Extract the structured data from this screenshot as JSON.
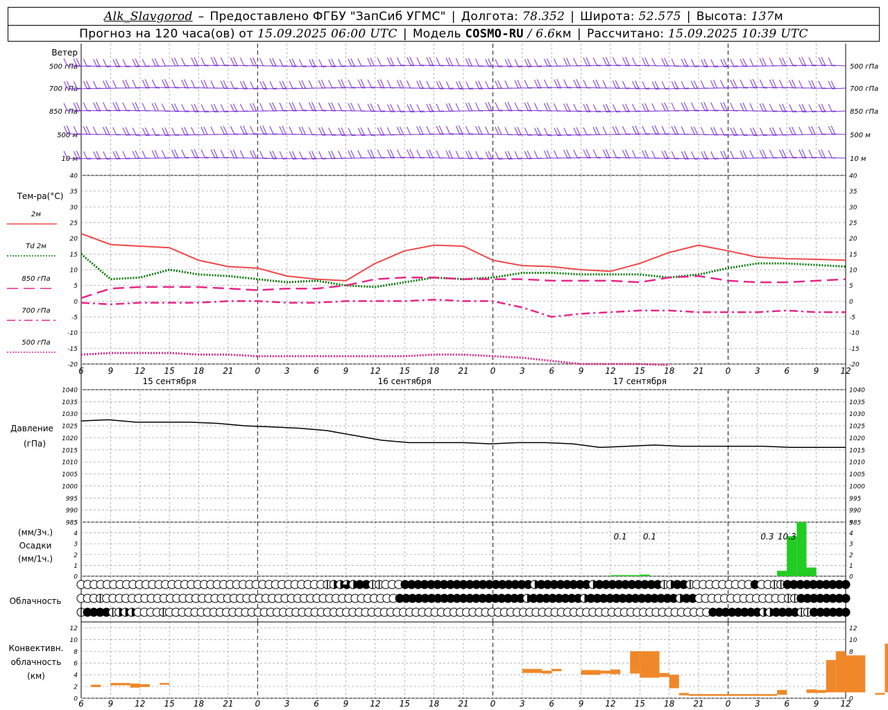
{
  "header": {
    "station": "Alk_Slavgorod",
    "dash": "–",
    "provider": "Предоставлено ФГБУ \"ЗапСиб УГМС\"",
    "lon_label": "Долгота:",
    "lon_value": "78.352",
    "lat_label": "Широта:",
    "lat_value": "52.575",
    "alt_label": "Высота:",
    "alt_value": "137",
    "alt_unit": "м",
    "forecast_prefix": "Прогноз на 120 часа(ов) от",
    "forecast_start": "15.09.2025 06:00 UTC",
    "model_label": "Модель",
    "model_name": "COSMO-RU",
    "model_res": "/ 6.6",
    "model_res_unit": "км",
    "calc_label": "Рассчитано:",
    "calc_time": "15.09.2025 10:39 UTC"
  },
  "colors": {
    "t2m": "#f04848",
    "td2m": "#007800",
    "t850": "#e8268a",
    "t700": "#e8268a",
    "t500": "#e8268a",
    "pressure": "#000000",
    "precip": "#22cc22",
    "conv": "#f0882a",
    "wind": "#7a2fd0",
    "grid": "#999999"
  },
  "chart_data": [
    {
      "type": "wind-barbs",
      "panel_label": "Ветер",
      "levels": [
        "500 гПа",
        "700 гПа",
        "850 гПа",
        "500 м",
        "10 м"
      ]
    },
    {
      "type": "line",
      "panel_label": "Тем-ра(°C)",
      "ylim": [
        -20,
        40
      ],
      "yticks": [
        -20,
        -15,
        -10,
        -5,
        0,
        5,
        10,
        15,
        20,
        25,
        30,
        35,
        40
      ],
      "x_hours": [
        0,
        3,
        6,
        9,
        12,
        15,
        18,
        21,
        24,
        27,
        30,
        33,
        36,
        39,
        42,
        45,
        48,
        51,
        54,
        57,
        60,
        63,
        66,
        69,
        72,
        75,
        78
      ],
      "series": [
        {
          "name": "2м",
          "key": "t2m",
          "style": "solid",
          "values": [
            21.5,
            18,
            17.5,
            17,
            13,
            11,
            10.5,
            8,
            7,
            6.5,
            12,
            16,
            17.8,
            17.5,
            13,
            11.3,
            11,
            10,
            9.5,
            12,
            15.5,
            17.8,
            16,
            14,
            13.5,
            13.3,
            13
          ]
        },
        {
          "name": "Td 2м",
          "key": "td2m",
          "style": "dotted",
          "values": [
            15,
            7,
            7.5,
            10,
            8.5,
            8,
            7,
            6,
            6.5,
            5,
            4.5,
            6,
            7.5,
            7,
            7.5,
            9,
            9,
            8.5,
            8.5,
            8.5,
            7.5,
            8.5,
            10.5,
            12,
            12,
            11.5,
            11
          ]
        },
        {
          "name": "850 гПа",
          "key": "t850",
          "style": "dashed",
          "values": [
            1,
            4,
            4.5,
            4.5,
            4.5,
            4,
            3.5,
            4,
            4,
            5,
            7,
            7.5,
            7.5,
            7,
            7,
            7,
            6.5,
            6.5,
            6.5,
            6,
            7.5,
            8,
            6.5,
            6,
            6,
            6.5,
            7
          ]
        },
        {
          "name": "700 гПа",
          "key": "t700",
          "style": "dashdot",
          "values": [
            -0.5,
            -1,
            -0.5,
            -0.5,
            -0.5,
            0,
            0,
            -0.5,
            -0.5,
            0,
            0,
            0,
            0.5,
            0,
            0,
            -2,
            -5,
            -4,
            -3.5,
            -3,
            -3,
            -3.5,
            -3.5,
            -3.5,
            -3,
            -3.5,
            -3.5
          ]
        },
        {
          "name": "500 гПа",
          "key": "t500",
          "style": "dotted",
          "values": [
            -17,
            -16.5,
            -16.5,
            -16.5,
            -17,
            -17,
            -17.5,
            -17.5,
            -17.5,
            -17.5,
            -17.5,
            -17.5,
            -17,
            -17,
            -17.5,
            -18,
            -19,
            -20,
            -20,
            -20,
            -20.3,
            null,
            null,
            null,
            null,
            null,
            null
          ]
        }
      ]
    },
    {
      "type": "line",
      "panel_label": "Давление",
      "panel_unit": "(гПа)",
      "ylim": [
        985,
        1040
      ],
      "yticks": [
        985,
        990,
        995,
        1000,
        1005,
        1010,
        1015,
        1020,
        1025,
        1030,
        1035,
        1040
      ],
      "series": [
        {
          "name": "Давление",
          "key": "pressure",
          "values": [
            1027,
            1027.5,
            1026.5,
            1026.5,
            1026.5,
            1026,
            1025,
            1024.5,
            1024,
            1023,
            1021,
            1019,
            1018,
            1018,
            1018,
            1017.5,
            1018,
            1018,
            1017.5,
            1016,
            1016.5,
            1017,
            1016.5,
            1016.5,
            1016.5,
            1016.5,
            1016,
            1016,
            1016
          ]
        }
      ]
    },
    {
      "type": "bar",
      "panel_label": "Осадки",
      "unit_3h": "(мм/3ч.)",
      "unit_1h": "(мм/1ч.)",
      "ylim": [
        0,
        5
      ],
      "yticks": [
        0,
        1,
        2,
        3,
        4,
        5
      ],
      "hours": [
        72,
        73,
        74,
        75,
        76,
        77,
        78,
        79,
        80,
        81,
        82,
        83,
        84,
        85,
        86,
        87,
        88,
        89,
        90,
        91,
        92,
        93,
        94,
        95,
        96,
        97,
        98,
        99,
        100,
        101,
        102,
        103,
        104,
        105,
        106,
        107,
        108,
        109,
        110,
        111,
        112,
        113,
        114,
        115,
        116,
        117,
        118,
        119,
        120
      ],
      "values": [
        0.1,
        0.1,
        0.1,
        0.1,
        0.15,
        0.2,
        0,
        0,
        0,
        0,
        0,
        0,
        0,
        0,
        0,
        0,
        0,
        0,
        0,
        0,
        0,
        0,
        0,
        0,
        0,
        0,
        0,
        0,
        0,
        0,
        0,
        0,
        0,
        0,
        0,
        0,
        0,
        0,
        0,
        0,
        0,
        0,
        0,
        0,
        0,
        0,
        0,
        0,
        0
      ],
      "bars2": [
        {
          "hour": 104,
          "value": 0.5
        },
        {
          "hour": 105,
          "value": 3.7
        },
        {
          "hour": 106,
          "value": 6
        },
        {
          "hour": 107,
          "value": 0.8
        }
      ],
      "labels": [
        {
          "hour": 73.5,
          "text": "0.1"
        },
        {
          "hour": 76.5,
          "text": "0.1"
        },
        {
          "hour": 103.5,
          "text": "0.3"
        },
        {
          "hour": 106.5,
          "text": "10.3"
        }
      ]
    },
    {
      "type": "cloud-symbols",
      "panel_label": "Облачность",
      "rows": [
        "ooooooooooooooooooooooooooooooooooooooqhhmhffqqoooffffffffffffffffffffhffffffffhffffffffffqhffqooooooooofooqqffffffffff",
        "oooqooooooooooooooooooooooooooooooooooooooooooooooffffffffffffffffffffhffffffffhffffffffffffffhffooooooooooooooqqffffffff",
        "qffffqhhhooooqooooooooooooooooooooooooooooooooooooooooooooooooooooooooooooooooooooooooooooooooooooooffffffffhhffffqqffffff"
      ]
    },
    {
      "type": "bar",
      "panel_label": "Конвективн. облачность",
      "panel_unit": "(км)",
      "ylim": [
        0,
        13
      ],
      "yticks": [
        0,
        2,
        4,
        6,
        8,
        10,
        12
      ],
      "segments": [
        {
          "h0": 1,
          "h1": 2,
          "b": 1.9,
          "t": 2.3
        },
        {
          "h0": 3,
          "h1": 5,
          "b": 2.2,
          "t": 2.6
        },
        {
          "h0": 5,
          "h1": 6,
          "b": 1.8,
          "t": 2.5
        },
        {
          "h0": 6,
          "h1": 7,
          "b": 1.9,
          "t": 2.4
        },
        {
          "h0": 8,
          "h1": 9,
          "b": 2.3,
          "t": 2.6
        },
        {
          "h0": 45,
          "h1": 47,
          "b": 4.3,
          "t": 5.0
        },
        {
          "h0": 47,
          "h1": 48,
          "b": 4.2,
          "t": 4.7
        },
        {
          "h0": 48,
          "h1": 49,
          "b": 4.6,
          "t": 5.0
        },
        {
          "h0": 51,
          "h1": 53,
          "b": 4.0,
          "t": 4.8
        },
        {
          "h0": 53,
          "h1": 54,
          "b": 4.2,
          "t": 4.7
        },
        {
          "h0": 54,
          "h1": 55,
          "b": 4.1,
          "t": 4.9
        },
        {
          "h0": 56,
          "h1": 57,
          "b": 4.2,
          "t": 8.0
        },
        {
          "h0": 57,
          "h1": 59,
          "b": 3.5,
          "t": 8.0
        },
        {
          "h0": 59,
          "h1": 60,
          "b": 3.6,
          "t": 4.3
        },
        {
          "h0": 60,
          "h1": 61,
          "b": 1.7,
          "t": 4.0
        },
        {
          "h0": 61,
          "h1": 62,
          "b": 0.5,
          "t": 0.9
        },
        {
          "h0": 62,
          "h1": 71,
          "b": 0.4,
          "t": 0.7
        },
        {
          "h0": 71,
          "h1": 72,
          "b": 0.6,
          "t": 1.4
        },
        {
          "h0": 74,
          "h1": 75,
          "b": 0.9,
          "t": 1.5
        },
        {
          "h0": 75,
          "h1": 76,
          "b": 0.9,
          "t": 1.4
        },
        {
          "h0": 76,
          "h1": 77,
          "b": 1.0,
          "t": 6.5
        },
        {
          "h0": 77,
          "h1": 78,
          "b": 1.0,
          "t": 8.0
        },
        {
          "h0": 78,
          "h1": 80,
          "b": 1.0,
          "t": 7.3
        },
        {
          "h0": 81,
          "h1": 82,
          "b": 0.6,
          "t": 0.9
        },
        {
          "h0": 82,
          "h1": 83,
          "b": 1.0,
          "t": 9.3
        },
        {
          "h0": 83,
          "h1": 84,
          "b": 2.5,
          "t": 4.0
        }
      ]
    }
  ],
  "x_axis": {
    "tick_labels": [
      "6",
      "9",
      "12",
      "15",
      "18",
      "21",
      "0",
      "3",
      "6",
      "9",
      "12",
      "15",
      "18",
      "21",
      "0",
      "3",
      "6",
      "9",
      "12",
      "15",
      "18",
      "21",
      "0",
      "3",
      "6",
      "9",
      "12"
    ],
    "days": [
      "15 сентября",
      "16 сентября",
      "17 сентября"
    ]
  }
}
